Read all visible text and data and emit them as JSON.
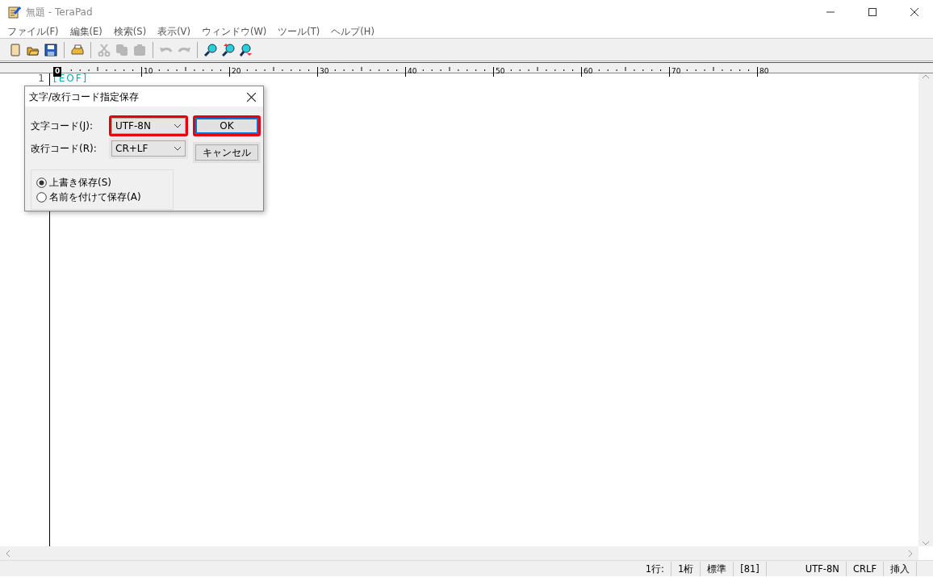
{
  "window": {
    "title": "無題 - TeraPad"
  },
  "menu": [
    "ファイル(F)",
    "編集(E)",
    "検索(S)",
    "表示(V)",
    "ウィンドウ(W)",
    "ツール(T)",
    "ヘルプ(H)"
  ],
  "toolbar": [
    {
      "kind": "new",
      "disabled": false
    },
    {
      "kind": "open",
      "disabled": false
    },
    {
      "kind": "save",
      "disabled": false
    },
    {
      "kind": "sep"
    },
    {
      "kind": "print",
      "disabled": false
    },
    {
      "kind": "sep"
    },
    {
      "kind": "cut",
      "disabled": true
    },
    {
      "kind": "copy",
      "disabled": true
    },
    {
      "kind": "paste",
      "disabled": true
    },
    {
      "kind": "sep"
    },
    {
      "kind": "undo",
      "disabled": true
    },
    {
      "kind": "redo",
      "disabled": true
    },
    {
      "kind": "sep"
    },
    {
      "kind": "find",
      "disabled": false
    },
    {
      "kind": "find-up",
      "disabled": false
    },
    {
      "kind": "find-down",
      "disabled": false
    }
  ],
  "ruler": [
    "0",
    "10",
    "20",
    "30",
    "40",
    "50",
    "60",
    "70",
    "80"
  ],
  "editor": {
    "line_numbers": [
      "1"
    ],
    "eof": "[EOF]"
  },
  "dialog": {
    "title": "文字/改行コード指定保存",
    "fields": [
      {
        "label": "文字コード(J):",
        "value": "UTF-8N",
        "highlighted": true
      },
      {
        "label": "改行コード(R):",
        "value": "CR+LF",
        "highlighted": false
      }
    ],
    "buttons": [
      {
        "label": "OK",
        "focused": true,
        "highlighted": true
      },
      {
        "label": "キャンセル",
        "focused": false,
        "highlighted": false
      }
    ],
    "options": [
      {
        "label": "上書き保存(S)",
        "selected": true
      },
      {
        "label": "名前を付けて保存(A)",
        "selected": false
      }
    ]
  },
  "status_bar": [
    "1行:",
    "1桁",
    "標準",
    "[81]",
    "UTF-8N",
    "CRLF",
    "挿入"
  ]
}
